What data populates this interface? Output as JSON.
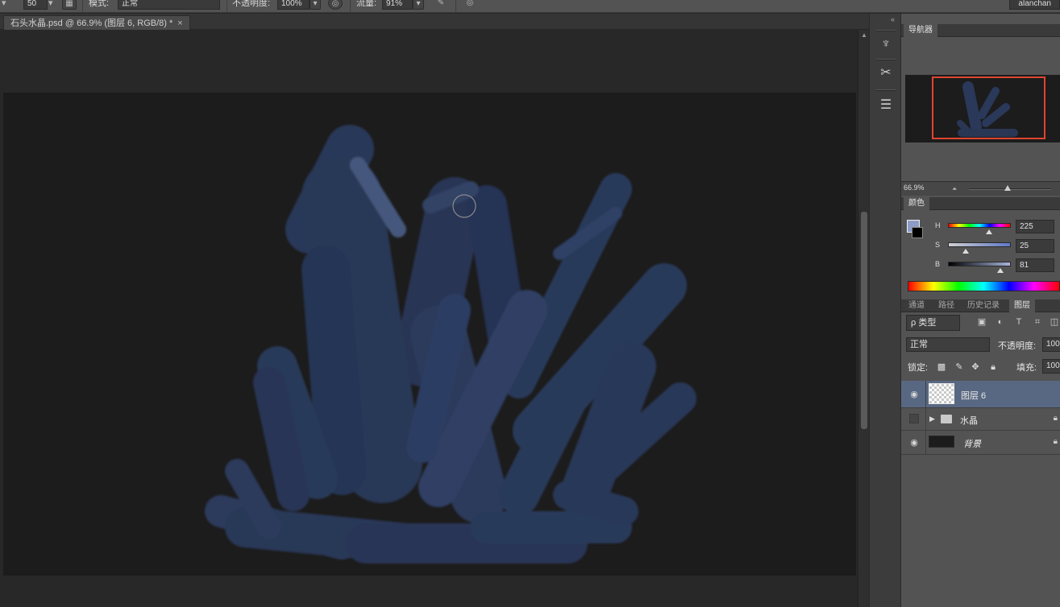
{
  "options_bar": {
    "brush_size": "50",
    "mode_label": "模式:",
    "mode_value": "正常",
    "opacity_label": "不透明度:",
    "opacity_value": "100%",
    "flow_label": "流量:",
    "flow_value": "91%",
    "user": "alanchan"
  },
  "document_tab": {
    "title": "石头水晶.psd @ 66.9% (图层 6, RGB/8) *",
    "close": "×"
  },
  "mini_toolbar": {
    "collapse": "«",
    "icons": [
      "brush-tool-icon",
      "brush-presets-icon",
      "adjustments-icon"
    ]
  },
  "navigator": {
    "tab": "导航器",
    "zoom": "66.9%"
  },
  "color_panel": {
    "tab": "颜色",
    "foreground": "#8d9bc9",
    "h_label": "H",
    "h_value": "225",
    "s_label": "S",
    "s_value": "25",
    "b_label": "B",
    "b_value": "81"
  },
  "layers_panel": {
    "tabs": [
      "通道",
      "路径",
      "历史记录",
      "图层"
    ],
    "active_tab": "图层",
    "filter_label": "ρ 类型",
    "blend_mode": "正常",
    "opacity_label": "不透明度:",
    "opacity_value": "100%",
    "lock_label": "锁定:",
    "fill_label": "填充:",
    "fill_value": "100%",
    "layers": [
      {
        "name": "图层 6",
        "visible": true,
        "selected": true
      },
      {
        "name": "水晶",
        "visible": false,
        "type": "group"
      },
      {
        "name": "背景",
        "visible": true,
        "locked": true
      }
    ]
  },
  "colors": {
    "crystal": "#2b3b5e",
    "crystal_highlight": "#4a5d85",
    "selection": "#596882",
    "nav_frame": "#e0452f"
  }
}
